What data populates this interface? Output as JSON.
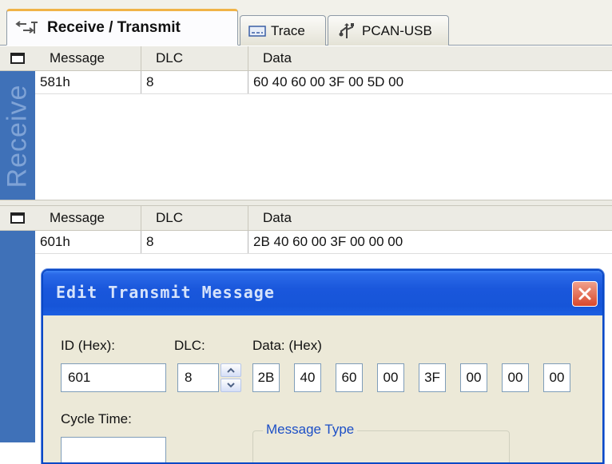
{
  "tabs": [
    {
      "label": "Receive / Transmit",
      "icon": "receive-transmit-icon",
      "active": true
    },
    {
      "label": "Trace",
      "icon": "trace-icon",
      "active": false
    },
    {
      "label": "PCAN-USB",
      "icon": "usb-icon",
      "active": false
    }
  ],
  "receive": {
    "side_label": "Receive",
    "columns": [
      "Message",
      "DLC",
      "Data"
    ],
    "rows": [
      {
        "message": "581h",
        "dlc": "8",
        "data": "60 40 60 00 3F 00 5D 00"
      }
    ]
  },
  "transmit": {
    "columns": [
      "Message",
      "DLC",
      "Data"
    ],
    "rows": [
      {
        "message": "601h",
        "dlc": "8",
        "data": "2B 40 60 00 3F 00 00 00"
      }
    ]
  },
  "dialog": {
    "title": "Edit Transmit Message",
    "id_label": "ID (Hex):",
    "dlc_label": "DLC:",
    "data_label": "Data: (Hex)",
    "id_value": "601",
    "dlc_value": "8",
    "data_bytes": [
      "2B",
      "40",
      "60",
      "00",
      "3F",
      "00",
      "00",
      "00"
    ],
    "cycle_time_label": "Cycle Time:",
    "message_type_label": "Message Type"
  },
  "colors": {
    "sidebar": "#3f71b8",
    "titlebar": "#1655d8",
    "close_button": "#d9482c",
    "active_tab_accent": "#f0b347"
  }
}
